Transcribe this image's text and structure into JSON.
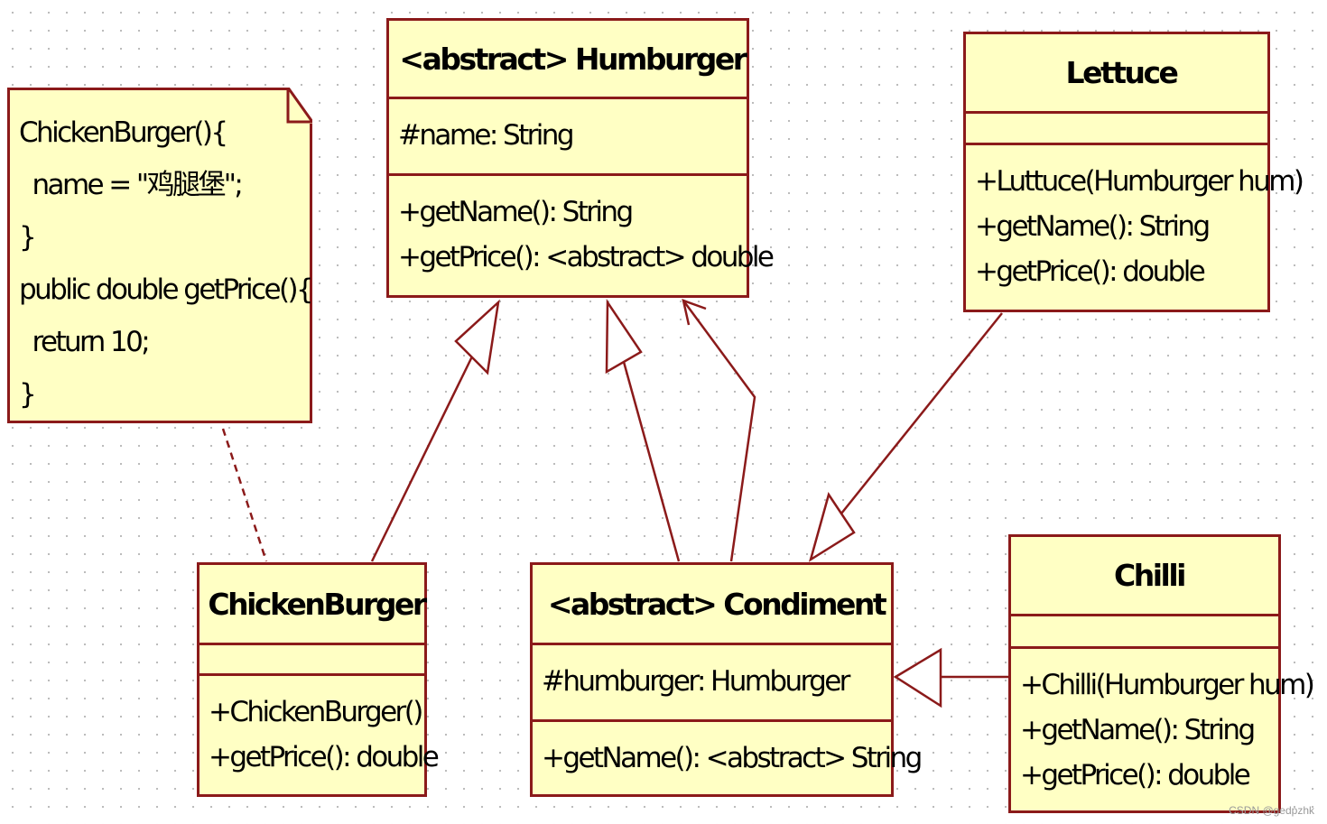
{
  "colors": {
    "fill": "#ffffc4",
    "border": "#8b1a1a"
  },
  "note": {
    "lines": [
      "ChickenBurger(){",
      "  name = \"鸡腿堡\";",
      "}",
      "public double getPrice(){",
      "  return 10;",
      "}"
    ]
  },
  "classes": {
    "humburger": {
      "name": "<abstract> Humburger",
      "attributes": [
        "#name: String"
      ],
      "methods": [
        "+getName(): String",
        "+getPrice(): <abstract> double"
      ]
    },
    "lettuce": {
      "name": "Lettuce",
      "attributes": [],
      "methods": [
        "+Luttuce(Humburger hum)",
        "+getName(): String",
        "+getPrice(): double"
      ]
    },
    "chickenburger": {
      "name": "ChickenBurger",
      "attributes": [],
      "methods": [
        "+ChickenBurger()",
        "+getPrice(): double"
      ]
    },
    "condiment": {
      "name": "<abstract> Condiment",
      "attributes": [
        "#humburger: Humburger"
      ],
      "methods": [
        "+getName(): <abstract> String"
      ]
    },
    "chilli": {
      "name": "Chilli",
      "attributes": [],
      "methods": [
        "+Chilli(Humburger hum)",
        "+getName(): String",
        "+getPrice(): double"
      ]
    }
  },
  "watermark": "CSDN @gedpzhk"
}
